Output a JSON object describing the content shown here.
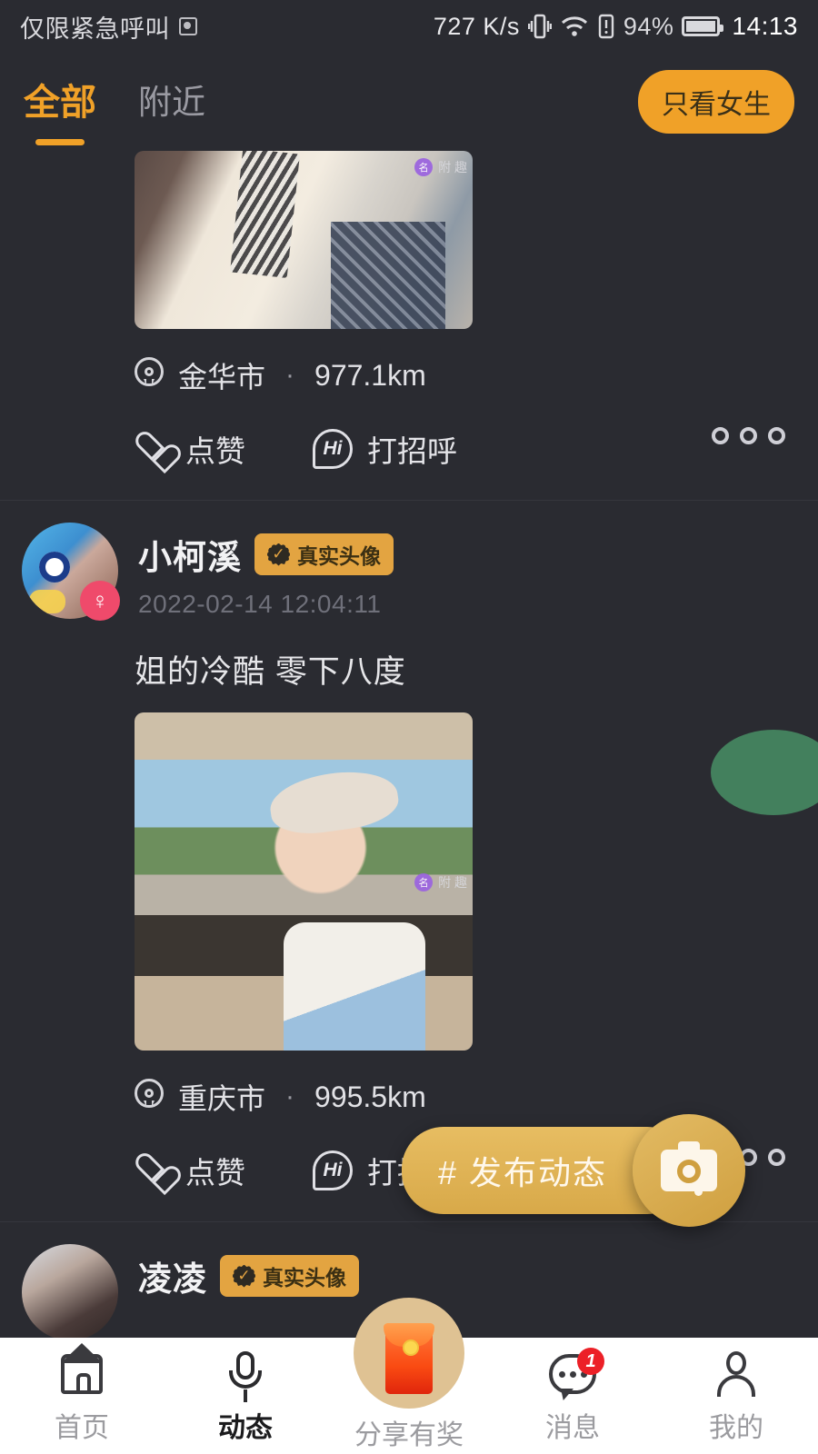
{
  "status_bar": {
    "carrier_text": "仅限紧急呼叫",
    "sim_icon": "sim-card-icon",
    "network_speed": "727 K/s",
    "vibrate_icon": "vibrate-icon",
    "wifi_icon": "wifi-icon",
    "battery_warning_icon": "battery-warning-icon",
    "battery_percent": "94%",
    "battery_icon": "battery-icon",
    "time": "14:13"
  },
  "header": {
    "tabs": [
      {
        "label": "全部",
        "active": true
      },
      {
        "label": "附近",
        "active": false
      }
    ],
    "filter_button": "只看女生",
    "accent_color": "#f0a128"
  },
  "feed": {
    "posts": [
      {
        "media_watermark": "附 趣",
        "location": "金华市",
        "separator": "·",
        "distance": "977.1km",
        "like_label": "点赞",
        "greet_label": "打招呼",
        "more_icon": "more-dots-icon"
      },
      {
        "username": "小柯溪",
        "verified_badge": "真实头像",
        "gender": "female",
        "timestamp": "2022-02-14 12:04:11",
        "text": "姐的冷酷 零下八度",
        "media_watermark": "附 趣",
        "location": "重庆市",
        "separator": "·",
        "distance": "995.5km",
        "like_label": "点赞",
        "greet_label": "打招呼",
        "more_icon": "more-dots-icon"
      },
      {
        "username": "凌凌",
        "verified_badge": "真实头像"
      }
    ]
  },
  "floating": {
    "publish_label": "# 发布动态",
    "camera_icon": "camera-icon",
    "green_bubble_color": "#43805d",
    "fab_color": "#d8a949"
  },
  "bottom_nav": {
    "items": [
      {
        "label": "首页",
        "icon": "home-icon",
        "active": false
      },
      {
        "label": "动态",
        "icon": "microphone-icon",
        "active": true
      },
      {
        "label": "分享有奖",
        "icon": "red-envelope-icon",
        "active": false
      },
      {
        "label": "消息",
        "icon": "chat-icon",
        "active": false,
        "badge": "1"
      },
      {
        "label": "我的",
        "icon": "user-icon",
        "active": false
      }
    ]
  }
}
